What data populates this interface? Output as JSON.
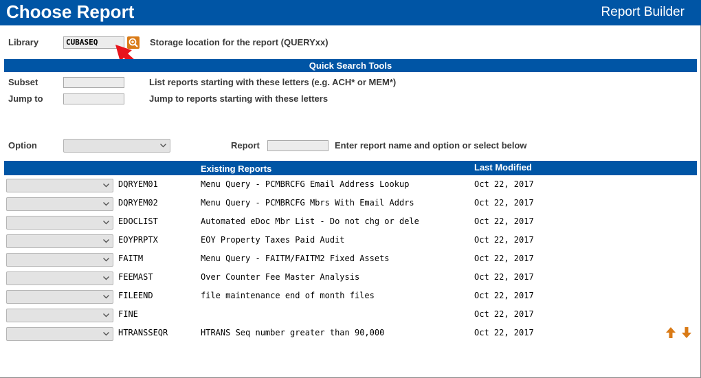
{
  "header": {
    "title": "Choose Report",
    "subtitle": "Report Builder"
  },
  "library": {
    "label": "Library",
    "value": "CUBASEQ",
    "hint": "Storage location for the report (QUERYxx)"
  },
  "quick_search": {
    "title": "Quick Search Tools",
    "subset_label": "Subset",
    "subset_hint": "List reports starting with these letters (e.g. ACH* or MEM*)",
    "jumpto_label": "Jump to",
    "jumpto_hint": "Jump to reports starting with these letters"
  },
  "option_row": {
    "option_label": "Option",
    "report_label": "Report",
    "report_hint": "Enter report name and option or select below"
  },
  "table": {
    "header_existing": "Existing Reports",
    "header_modified": "Last Modified",
    "rows": [
      {
        "name": "DQRYEM01",
        "desc": "Menu Query - PCMBRCFG Email Address Lookup",
        "date": "Oct 22, 2017"
      },
      {
        "name": "DQRYEM02",
        "desc": "Menu Query - PCMBRCFG Mbrs With Email Addrs",
        "date": "Oct 22, 2017"
      },
      {
        "name": "EDOCLIST",
        "desc": "Automated eDoc Mbr List - Do not chg or dele",
        "date": "Oct 22, 2017"
      },
      {
        "name": "EOYPRPTX",
        "desc": "EOY Property Taxes Paid Audit",
        "date": "Oct 22, 2017"
      },
      {
        "name": "FAITM",
        "desc": "Menu Query - FAITM/FAITM2 Fixed Assets",
        "date": "Oct 22, 2017"
      },
      {
        "name": "FEEMAST",
        "desc": "Over Counter Fee Master Analysis",
        "date": "Oct 22, 2017"
      },
      {
        "name": "FILEEND",
        "desc": "file maintenance end of month files",
        "date": "Oct 22, 2017"
      },
      {
        "name": "FINE",
        "desc": "",
        "date": "Oct 22, 2017"
      },
      {
        "name": "HTRANSSEQR",
        "desc": "HTRANS Seq number greater than 90,000",
        "date": "Oct 22, 2017"
      }
    ]
  },
  "icons": {
    "lookup": "magnifier-plus-icon",
    "annotation": "red-arrow-pointer",
    "page_up": "arrow-up-icon",
    "page_down": "arrow-down-icon"
  },
  "colors": {
    "header_blue": "#0055a5",
    "accent_orange": "#d97a16",
    "annotation_red": "#e8141c"
  }
}
